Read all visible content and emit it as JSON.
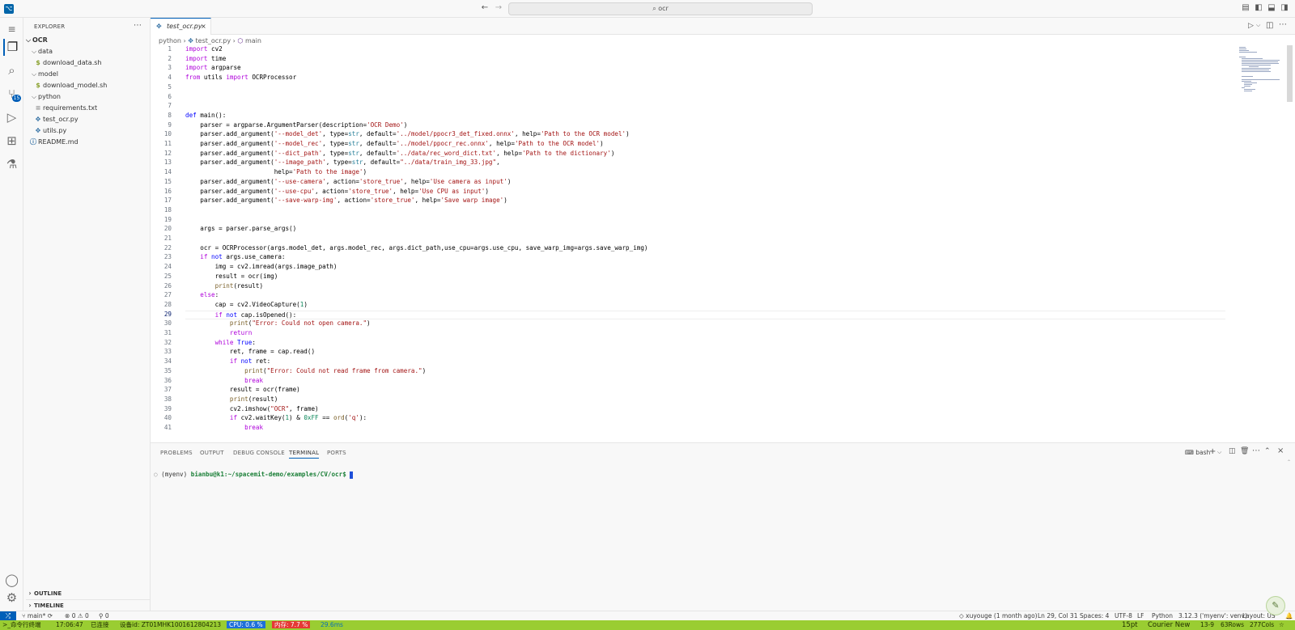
{
  "window": {
    "app_icon": "vscode-logo",
    "search_text": "ocr"
  },
  "sidebar": {
    "title": "EXPLORER",
    "root": "OCR",
    "tree": [
      {
        "label": "data",
        "kind": "folder",
        "depth": 1
      },
      {
        "label": "download_data.sh",
        "kind": "shell",
        "depth": 2
      },
      {
        "label": "model",
        "kind": "folder",
        "depth": 1
      },
      {
        "label": "download_model.sh",
        "kind": "shell",
        "depth": 2
      },
      {
        "label": "python",
        "kind": "folder",
        "depth": 1
      },
      {
        "label": "requirements.txt",
        "kind": "text",
        "depth": 2
      },
      {
        "label": "test_ocr.py",
        "kind": "python",
        "depth": 2
      },
      {
        "label": "utils.py",
        "kind": "python",
        "depth": 2
      },
      {
        "label": "README.md",
        "kind": "markdown",
        "depth": 1
      }
    ],
    "outline_label": "OUTLINE",
    "timeline_label": "TIMELINE",
    "scm_badge": "15"
  },
  "editor": {
    "tab_label": "test_ocr.py",
    "breadcrumb": {
      "folder": "python",
      "file": "test_ocr.py",
      "symbol": "main"
    },
    "lines": [
      "import cv2",
      "import time",
      "import argparse",
      "from utils import OCRProcessor",
      "",
      "",
      "",
      "def main():",
      "    parser = argparse.ArgumentParser(description='OCR Demo')",
      "    parser.add_argument('--model_det', type=str, default='../model/ppocr3_det_fixed.onnx', help='Path to the OCR model')",
      "    parser.add_argument('--model_rec', type=str, default='../model/ppocr_rec.onnx', help='Path to the OCR model')",
      "    parser.add_argument('--dict_path', type=str, default='../data/rec_word_dict.txt', help='Path to the dictionary')",
      "    parser.add_argument('--image_path', type=str, default=\"../data/train_img_33.jpg\",",
      "                        help='Path to the image')",
      "    parser.add_argument('--use-camera', action='store_true', help='Use camera as input')",
      "    parser.add_argument('--use-cpu', action='store_true', help='Use CPU as input')",
      "    parser.add_argument('--save-warp-img', action='store_true', help='Save warp image')",
      "",
      "",
      "    args = parser.parse_args()",
      "",
      "    ocr = OCRProcessor(args.model_det, args.model_rec, args.dict_path,use_cpu=args.use_cpu, save_warp_img=args.save_warp_img)",
      "    if not args.use_camera:",
      "        img = cv2.imread(args.image_path)",
      "        result = ocr(img)",
      "        print(result)",
      "    else:",
      "        cap = cv2.VideoCapture(1)",
      "        if not cap.isOpened():",
      "            print(\"Error: Could not open camera.\")",
      "            return",
      "        while True:",
      "            ret, frame = cap.read()",
      "            if not ret:",
      "                print(\"Error: Could not read frame from camera.\")",
      "                break",
      "            result = ocr(frame)",
      "            print(result)",
      "            cv2.imshow(\"OCR\", frame)",
      "            if cv2.waitKey(1) & 0xFF == ord('q'):",
      "                break"
    ]
  },
  "panel": {
    "tabs": [
      "PROBLEMS",
      "OUTPUT",
      "DEBUG CONSOLE",
      "TERMINAL",
      "PORTS"
    ],
    "active_tab": "TERMINAL",
    "shell_label": "bash",
    "prompt_env": "(myenv)",
    "prompt_user": "bianbu@k1:~/spacemit-demo/examples/CV/ocr$"
  },
  "statusbar": {
    "branch": "main*",
    "errors": "0",
    "warnings": "0",
    "ports": "0",
    "blame": "xuyouge (1 month ago)",
    "position": "Ln 29, Col 31",
    "spaces": "Spaces: 4",
    "encoding": "UTF-8",
    "eol": "LF",
    "language": "Python",
    "interpreter": "3.12.3 ('myenv': venv)",
    "layout": "Layout: US"
  },
  "bottombar": {
    "terminal_label": "命令行终端",
    "time": "17:06:47",
    "connection": "已连接",
    "device": "设备id: ZT01MHK1001612804213",
    "cpu": "CPU: 0.6 %",
    "memory": "内存: 7.7 %",
    "latency": "29.6ms",
    "font_size": "15pt",
    "font_name": "Courier New",
    "cursor": "13-9",
    "rows": "63Rows",
    "cols": "277Cols"
  }
}
